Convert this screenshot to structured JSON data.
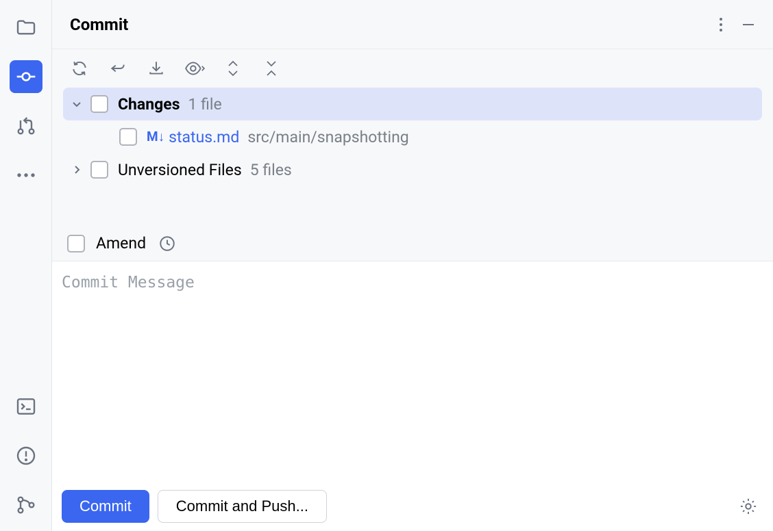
{
  "header": {
    "title": "Commit"
  },
  "tree": {
    "changes_label": "Changes",
    "changes_count": "1 file",
    "file": {
      "icon_text": "M↓",
      "name": "status.md",
      "path": "src/main/snapshotting"
    },
    "unversioned_label": "Unversioned Files",
    "unversioned_count": "5 files"
  },
  "amend": {
    "label": "Amend"
  },
  "commit_msg": {
    "placeholder": "Commit Message",
    "value": ""
  },
  "footer": {
    "commit": "Commit",
    "commit_push": "Commit and Push..."
  }
}
